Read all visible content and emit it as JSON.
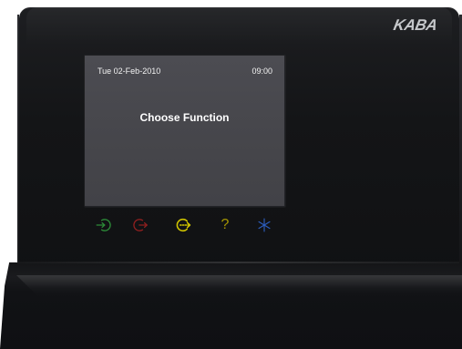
{
  "brand": {
    "logo_text": "KABA"
  },
  "screen": {
    "date": "Tue 02-Feb-2010",
    "time": "09:00",
    "message": "Choose Function"
  },
  "buttons": [
    {
      "icon": "arrow-in-circle-icon",
      "color": "#2c8b38"
    },
    {
      "icon": "arrow-out-circle-icon",
      "color": "#8f1f1f"
    },
    {
      "icon": "arrow-right-circle-icon",
      "color": "#cfc300"
    },
    {
      "icon": "question-mark-icon",
      "color": "#b6a500",
      "label": "?"
    },
    {
      "icon": "star-icon",
      "color": "#2c5dbe"
    }
  ]
}
